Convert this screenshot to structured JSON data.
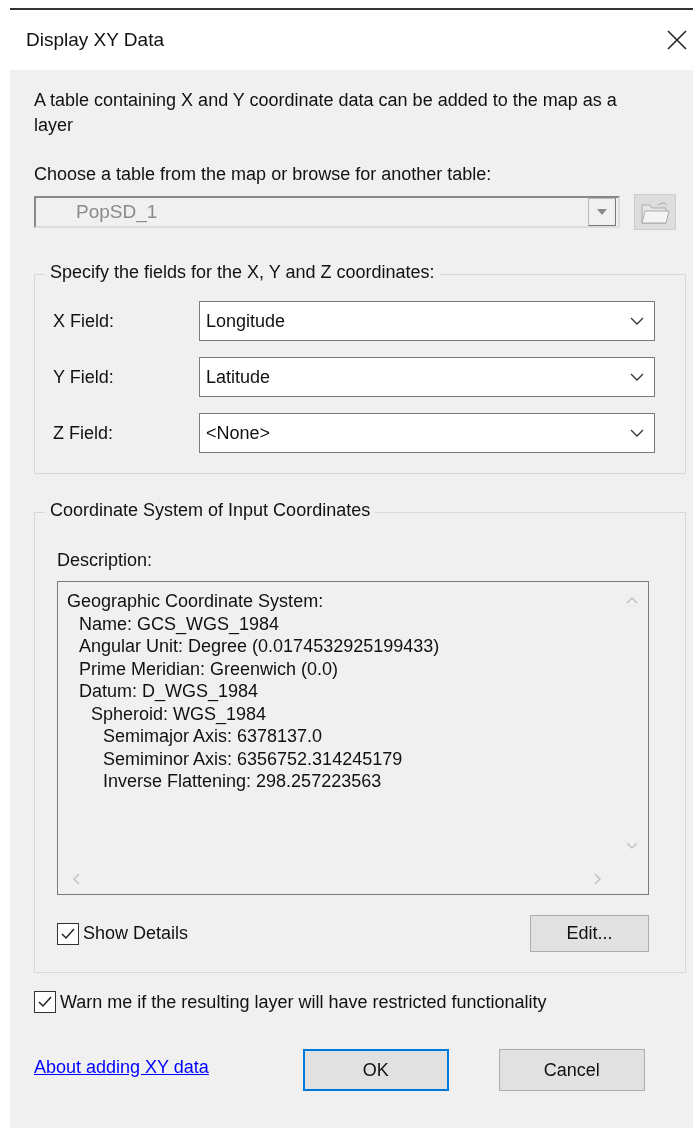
{
  "window": {
    "title": "Display XY Data"
  },
  "intro": "A table containing X and Y coordinate data can be added to the map as a layer",
  "table_prompt": "Choose a table from the map or browse for another table:",
  "table_combo": {
    "value": "PopSD_1",
    "disabled": true
  },
  "fields_group": {
    "title": "Specify the fields for the X, Y and Z coordinates:",
    "fields": [
      {
        "label": "X Field:",
        "value": "Longitude"
      },
      {
        "label": "Y Field:",
        "value": "Latitude"
      },
      {
        "label": "Z Field:",
        "value": "<None>"
      }
    ]
  },
  "coord_group": {
    "title": "Coordinate System of Input Coordinates",
    "description_label": "Description:",
    "description": [
      {
        "text": "Geographic Coordinate System:",
        "children": [
          {
            "text": "Name: GCS_WGS_1984"
          },
          {
            "text": "Angular Unit: Degree (0.0174532925199433)"
          },
          {
            "text": "Prime Meridian: Greenwich (0.0)"
          },
          {
            "text": "Datum: D_WGS_1984",
            "children": [
              {
                "text": "Spheroid: WGS_1984",
                "children": [
                  {
                    "text": "Semimajor Axis: 6378137.0"
                  },
                  {
                    "text": "Semiminor Axis: 6356752.314245179"
                  },
                  {
                    "text": "Inverse Flattening: 298.257223563"
                  }
                ]
              }
            ]
          }
        ]
      }
    ],
    "show_details": {
      "label": "Show Details",
      "checked": true
    },
    "edit_button": "Edit..."
  },
  "warn": {
    "label": "Warn me if the resulting layer will have restricted functionality",
    "checked": true
  },
  "help_link": "About adding XY data",
  "buttons": [
    {
      "label": "OK",
      "default": true
    },
    {
      "label": "Cancel",
      "default": false
    }
  ]
}
